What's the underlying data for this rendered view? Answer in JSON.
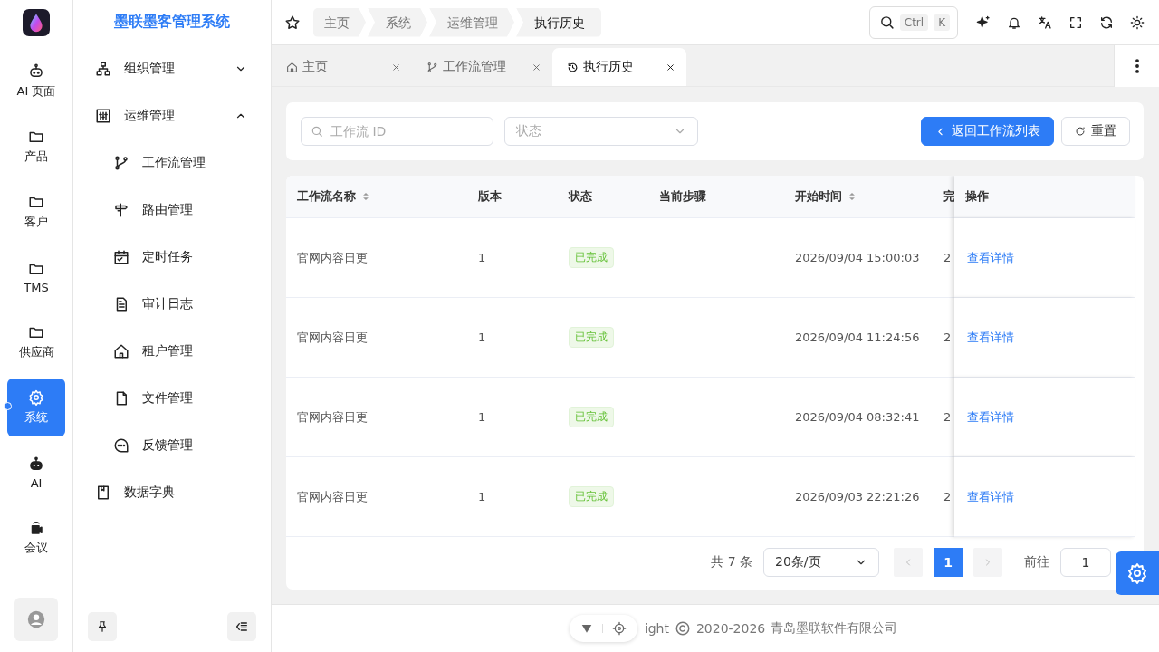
{
  "app": {
    "title": "墨联墨客管理系统"
  },
  "rail": [
    {
      "label": "AI 页面",
      "selected": false
    },
    {
      "label": "产品",
      "selected": false
    },
    {
      "label": "客户",
      "selected": false
    },
    {
      "label": "TMS",
      "selected": false
    },
    {
      "label": "供应商",
      "selected": false
    },
    {
      "label": "系统",
      "selected": true
    },
    {
      "label": "AI",
      "selected": false
    },
    {
      "label": "会议",
      "selected": false
    }
  ],
  "sidebar": {
    "items": [
      {
        "label": "组织管理",
        "expanded": false
      },
      {
        "label": "运维管理",
        "expanded": true,
        "children": [
          {
            "label": "工作流管理"
          },
          {
            "label": "路由管理"
          },
          {
            "label": "定时任务"
          },
          {
            "label": "审计日志"
          },
          {
            "label": "租户管理"
          },
          {
            "label": "文件管理"
          },
          {
            "label": "反馈管理"
          }
        ]
      },
      {
        "label": "数据字典"
      }
    ]
  },
  "breadcrumb": [
    "主页",
    "系统",
    "运维管理",
    "执行历史"
  ],
  "search": {
    "keys": [
      "Ctrl",
      "K"
    ]
  },
  "tabs": [
    {
      "label": "主页",
      "selected": false
    },
    {
      "label": "工作流管理",
      "selected": false
    },
    {
      "label": "执行历史",
      "selected": true
    }
  ],
  "filters": {
    "id_placeholder": "工作流 ID",
    "status_placeholder": "状态",
    "back_button": "返回工作流列表",
    "reset_button": "重置"
  },
  "table": {
    "columns": [
      {
        "label": "工作流名称",
        "sortable": true
      },
      {
        "label": "版本",
        "sortable": false
      },
      {
        "label": "状态",
        "sortable": false
      },
      {
        "label": "当前步骤",
        "sortable": false
      },
      {
        "label": "开始时间",
        "sortable": true
      },
      {
        "label": "完"
      },
      {
        "label": "操作",
        "sortable": false
      }
    ],
    "rows": [
      {
        "name": "官网内容日更",
        "version": "1",
        "status": "已完成",
        "step": "",
        "start": "2026/09/04 15:00:03",
        "column_6": "2",
        "action": "查看详情"
      },
      {
        "name": "官网内容日更",
        "version": "1",
        "status": "已完成",
        "step": "",
        "start": "2026/09/04 11:24:56",
        "column_6": "2",
        "action": "查看详情"
      },
      {
        "name": "官网内容日更",
        "version": "1",
        "status": "已完成",
        "step": "",
        "start": "2026/09/04 08:32:41",
        "column_6": "2",
        "action": "查看详情"
      },
      {
        "name": "官网内容日更",
        "version": "1",
        "status": "已完成",
        "step": "",
        "start": "2026/09/03 22:21:26",
        "column_6": "2",
        "action": "查看详情"
      }
    ]
  },
  "pagination": {
    "total": "共 7 条",
    "page_size": "20条/页",
    "pages": [
      {
        "label": "1",
        "selected": true
      }
    ],
    "goto_label": "前往",
    "goto_value": "1"
  },
  "footer": {
    "text": "ight",
    "year": "2020-2026",
    "company": "青岛墨联软件有限公司"
  }
}
